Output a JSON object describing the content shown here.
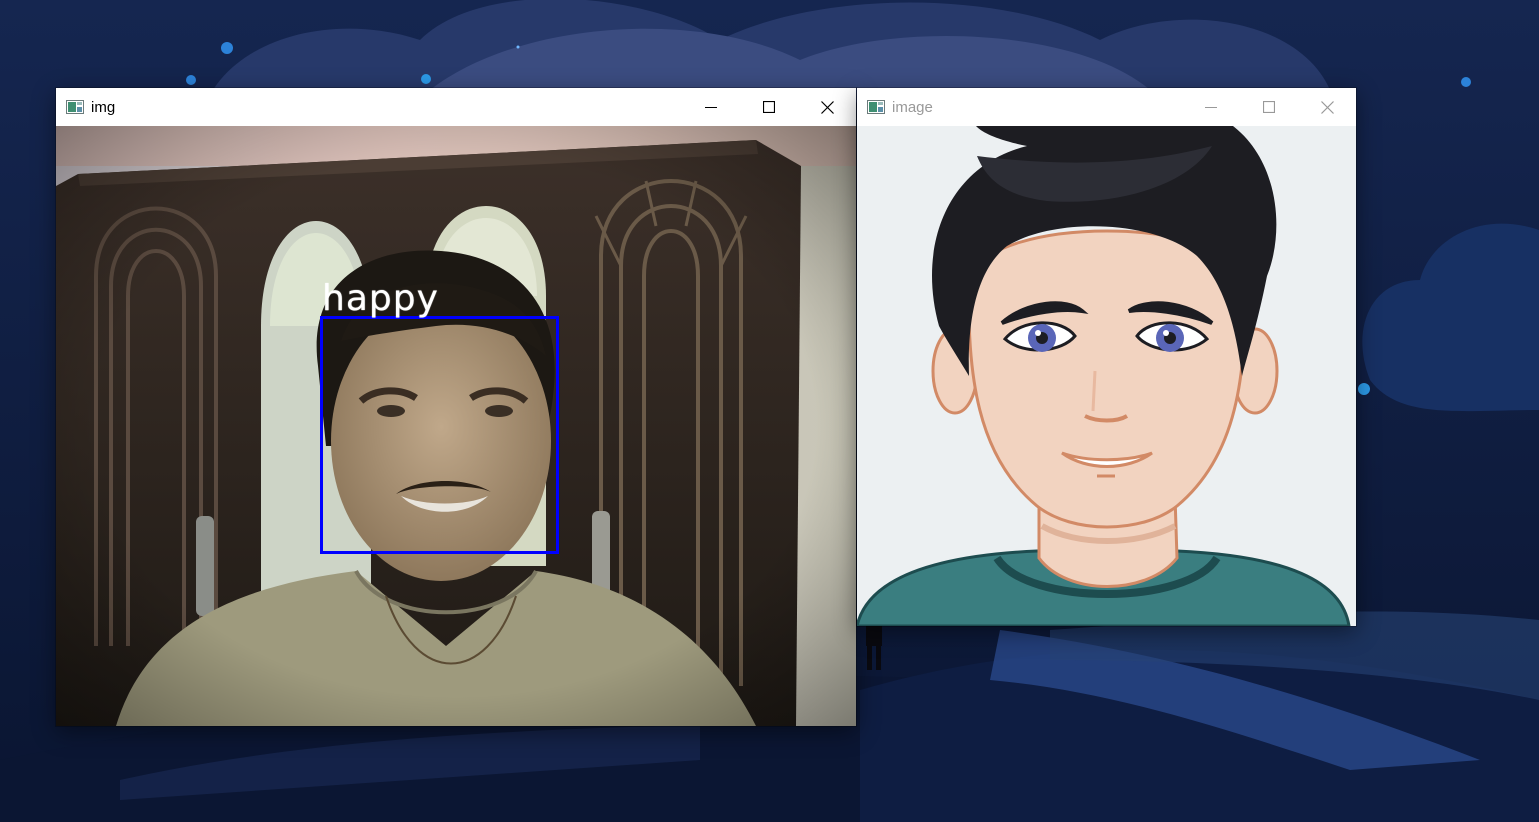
{
  "colors": {
    "desktop_bg": "#0c1833",
    "face_box": "#0000ff",
    "label_text": "#ffffff",
    "avatar_bg": "#ecf0f2",
    "shirt": "#3a8082",
    "hair": "#1d1d22",
    "skin": "#f2d3c0"
  },
  "webcam_window": {
    "title": "img",
    "icon": "window-app-icon",
    "active": true,
    "detection": {
      "label": "happy"
    }
  },
  "avatar_window": {
    "title": "image",
    "icon": "window-app-icon",
    "active": false
  },
  "window_controls": [
    "minimize-icon",
    "maximize-icon",
    "close-icon"
  ]
}
